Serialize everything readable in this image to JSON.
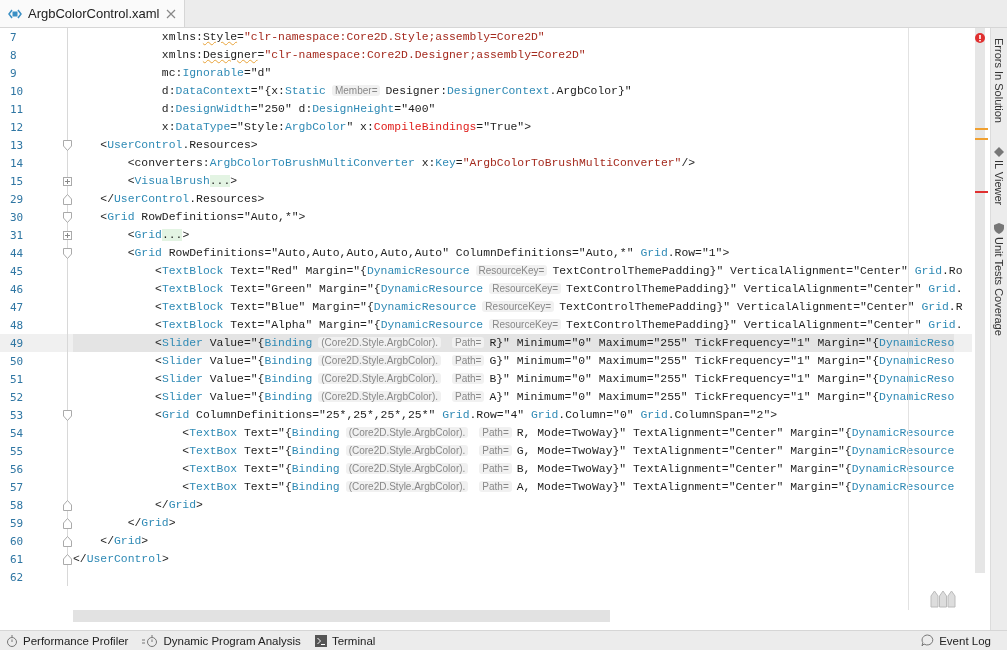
{
  "tabs": [
    {
      "label": "ArgbColorControl.xaml",
      "selected": true
    }
  ],
  "editor": {
    "lines": [
      {
        "number": "7",
        "current": false,
        "kind": "plain",
        "tokens": [
          {
            "kind": "p",
            "text": "             xmlns:"
          },
          {
            "kind": "w",
            "text": "Style"
          },
          {
            "kind": "p",
            "text": "="
          },
          {
            "kind": "s",
            "text": "\"clr-namespace:Core2D.Style;assembly=Core2D\""
          }
        ]
      },
      {
        "number": "8",
        "current": false,
        "kind": "plain",
        "tokens": [
          {
            "kind": "p",
            "text": "             xmlns:"
          },
          {
            "kind": "w",
            "text": "Designer"
          },
          {
            "kind": "p",
            "text": "="
          },
          {
            "kind": "s",
            "text": "\"clr-namespace:Core2D.Designer;assembly=Core2D\""
          }
        ]
      },
      {
        "number": "9",
        "current": false,
        "kind": "plain",
        "tokens": [
          {
            "kind": "p",
            "text": "             mc:"
          },
          {
            "kind": "t",
            "text": "Ignorable"
          },
          {
            "kind": "p",
            "text": "=\"d\""
          }
        ]
      },
      {
        "number": "10",
        "current": false,
        "kind": "plain",
        "tokens": [
          {
            "kind": "p",
            "text": "             d:"
          },
          {
            "kind": "t",
            "text": "DataContext"
          },
          {
            "kind": "p",
            "text": "=\"{x:"
          },
          {
            "kind": "t",
            "text": "Static"
          },
          {
            "kind": "h",
            "text": "Member="
          },
          {
            "kind": "p",
            "text": "Designer:"
          },
          {
            "kind": "t",
            "text": "DesignerContext"
          },
          {
            "kind": "p",
            "text": ".ArgbColor}\""
          }
        ]
      },
      {
        "number": "11",
        "current": false,
        "kind": "plain",
        "tokens": [
          {
            "kind": "p",
            "text": "             d:"
          },
          {
            "kind": "t",
            "text": "DesignWidth"
          },
          {
            "kind": "p",
            "text": "=\"250\" d:"
          },
          {
            "kind": "t",
            "text": "DesignHeight"
          },
          {
            "kind": "p",
            "text": "=\"400\""
          }
        ]
      },
      {
        "number": "12",
        "current": false,
        "kind": "plain",
        "tokens": [
          {
            "kind": "p",
            "text": "             x:"
          },
          {
            "kind": "t",
            "text": "DataType"
          },
          {
            "kind": "p",
            "text": "=\"Style:"
          },
          {
            "kind": "t",
            "text": "ArgbColor"
          },
          {
            "kind": "p",
            "text": "\" x:"
          },
          {
            "kind": "r",
            "text": "CompileBindings"
          },
          {
            "kind": "p",
            "text": "=\"True\">"
          }
        ]
      },
      {
        "number": "13",
        "current": false,
        "kind": "fold_start",
        "tokens": [
          {
            "kind": "p",
            "text": "    <"
          },
          {
            "kind": "t",
            "text": "UserControl"
          },
          {
            "kind": "p",
            "text": ".Resources>"
          }
        ]
      },
      {
        "number": "14",
        "current": false,
        "kind": "plain",
        "tokens": [
          {
            "kind": "p",
            "text": "        <converters:"
          },
          {
            "kind": "t",
            "text": "ArgbColorToBrushMultiConverter"
          },
          {
            "kind": "p",
            "text": " x:"
          },
          {
            "kind": "t",
            "text": "Key"
          },
          {
            "kind": "p",
            "text": "="
          },
          {
            "kind": "s",
            "text": "\"ArgbColorToBrushMultiConverter\""
          },
          {
            "kind": "p",
            "text": "/>"
          }
        ]
      },
      {
        "number": "15",
        "current": false,
        "kind": "collapsed",
        "tokens": [
          {
            "kind": "p",
            "text": "        <"
          },
          {
            "kind": "t",
            "text": "VisualBrush"
          },
          {
            "kind": "f",
            "text": "..."
          },
          {
            "kind": "p",
            "text": ">"
          }
        ]
      },
      {
        "number": "29",
        "current": false,
        "kind": "fold_end",
        "tokens": [
          {
            "kind": "p",
            "text": "    </"
          },
          {
            "kind": "t",
            "text": "UserControl"
          },
          {
            "kind": "p",
            "text": ".Resources>"
          }
        ]
      },
      {
        "number": "30",
        "current": false,
        "kind": "fold_start",
        "tokens": [
          {
            "kind": "p",
            "text": "    <"
          },
          {
            "kind": "t",
            "text": "Grid"
          },
          {
            "kind": "p",
            "text": " RowDefinitions=\"Auto,*\">"
          }
        ]
      },
      {
        "number": "31",
        "current": false,
        "kind": "collapsed",
        "tokens": [
          {
            "kind": "p",
            "text": "        <"
          },
          {
            "kind": "t",
            "text": "Grid"
          },
          {
            "kind": "f",
            "text": "..."
          },
          {
            "kind": "p",
            "text": ">"
          }
        ]
      },
      {
        "number": "44",
        "current": false,
        "kind": "fold_start",
        "tokens": [
          {
            "kind": "p",
            "text": "        <"
          },
          {
            "kind": "t",
            "text": "Grid"
          },
          {
            "kind": "p",
            "text": " RowDefinitions=\"Auto,Auto,Auto,Auto,Auto\" ColumnDefinitions=\"Auto,*\" "
          },
          {
            "kind": "t",
            "text": "Grid"
          },
          {
            "kind": "p",
            "text": ".Row=\"1\">"
          }
        ]
      },
      {
        "number": "45",
        "current": false,
        "kind": "plain",
        "tokens": [
          {
            "kind": "p",
            "text": "            <"
          },
          {
            "kind": "t",
            "text": "TextBlock"
          },
          {
            "kind": "p",
            "text": " Text=\"Red\" Margin=\"{"
          },
          {
            "kind": "t",
            "text": "DynamicResource"
          },
          {
            "kind": "h",
            "text": "ResourceKey="
          },
          {
            "kind": "p",
            "text": "TextControlThemePadding}\" VerticalAlignment=\"Center\" "
          },
          {
            "kind": "t",
            "text": "Grid"
          },
          {
            "kind": "p",
            "text": ".Ro"
          }
        ]
      },
      {
        "number": "46",
        "current": false,
        "kind": "plain",
        "tokens": [
          {
            "kind": "p",
            "text": "            <"
          },
          {
            "kind": "t",
            "text": "TextBlock"
          },
          {
            "kind": "p",
            "text": " Text=\"Green\" Margin=\"{"
          },
          {
            "kind": "t",
            "text": "DynamicResource"
          },
          {
            "kind": "h",
            "text": "ResourceKey="
          },
          {
            "kind": "p",
            "text": "TextControlThemePadding}\" VerticalAlignment=\"Center\" "
          },
          {
            "kind": "t",
            "text": "Grid"
          },
          {
            "kind": "p",
            "text": "."
          }
        ]
      },
      {
        "number": "47",
        "current": false,
        "kind": "plain",
        "tokens": [
          {
            "kind": "p",
            "text": "            <"
          },
          {
            "kind": "t",
            "text": "TextBlock"
          },
          {
            "kind": "p",
            "text": " Text=\"Blue\" Margin=\"{"
          },
          {
            "kind": "t",
            "text": "DynamicResource"
          },
          {
            "kind": "h",
            "text": "ResourceKey="
          },
          {
            "kind": "p",
            "text": "TextControlThemePadding}\" VerticalAlignment=\"Center\" "
          },
          {
            "kind": "t",
            "text": "Grid"
          },
          {
            "kind": "p",
            "text": ".R"
          }
        ]
      },
      {
        "number": "48",
        "current": false,
        "kind": "plain",
        "tokens": [
          {
            "kind": "p",
            "text": "            <"
          },
          {
            "kind": "t",
            "text": "TextBlock"
          },
          {
            "kind": "p",
            "text": " Text=\"Alpha\" Margin=\"{"
          },
          {
            "kind": "t",
            "text": "DynamicResource"
          },
          {
            "kind": "h",
            "text": "ResourceKey="
          },
          {
            "kind": "p",
            "text": "TextControlThemePadding}\" VerticalAlignment=\"Center\" "
          },
          {
            "kind": "t",
            "text": "Grid"
          },
          {
            "kind": "p",
            "text": "."
          }
        ]
      },
      {
        "number": "49",
        "current": true,
        "kind": "plain",
        "tokens": [
          {
            "kind": "p",
            "text": "            <"
          },
          {
            "kind": "t",
            "text": "Slider"
          },
          {
            "kind": "p",
            "text": " Value=\"{"
          },
          {
            "kind": "t",
            "text": "Binding"
          },
          {
            "kind": "h",
            "text": "(Core2D.Style.ArgbColor)."
          },
          {
            "kind": "h",
            "text": "Path="
          },
          {
            "kind": "p",
            "text": "R}\" Minimum=\"0\" Maximum=\"255\" TickFrequency=\"1\" Margin=\"{"
          },
          {
            "kind": "t",
            "text": "DynamicReso"
          }
        ]
      },
      {
        "number": "50",
        "current": false,
        "kind": "plain",
        "tokens": [
          {
            "kind": "p",
            "text": "            <"
          },
          {
            "kind": "t",
            "text": "Slider"
          },
          {
            "kind": "p",
            "text": " Value=\"{"
          },
          {
            "kind": "t",
            "text": "Binding"
          },
          {
            "kind": "h",
            "text": "(Core2D.Style.ArgbColor)."
          },
          {
            "kind": "h",
            "text": "Path="
          },
          {
            "kind": "p",
            "text": "G}\" Minimum=\"0\" Maximum=\"255\" TickFrequency=\"1\" Margin=\"{"
          },
          {
            "kind": "t",
            "text": "DynamicReso"
          }
        ]
      },
      {
        "number": "51",
        "current": false,
        "kind": "plain",
        "tokens": [
          {
            "kind": "p",
            "text": "            <"
          },
          {
            "kind": "t",
            "text": "Slider"
          },
          {
            "kind": "p",
            "text": " Value=\"{"
          },
          {
            "kind": "t",
            "text": "Binding"
          },
          {
            "kind": "h",
            "text": "(Core2D.Style.ArgbColor)."
          },
          {
            "kind": "h",
            "text": "Path="
          },
          {
            "kind": "p",
            "text": "B}\" Minimum=\"0\" Maximum=\"255\" TickFrequency=\"1\" Margin=\"{"
          },
          {
            "kind": "t",
            "text": "DynamicReso"
          }
        ]
      },
      {
        "number": "52",
        "current": false,
        "kind": "plain",
        "tokens": [
          {
            "kind": "p",
            "text": "            <"
          },
          {
            "kind": "t",
            "text": "Slider"
          },
          {
            "kind": "p",
            "text": " Value=\"{"
          },
          {
            "kind": "t",
            "text": "Binding"
          },
          {
            "kind": "h",
            "text": "(Core2D.Style.ArgbColor)."
          },
          {
            "kind": "h",
            "text": "Path="
          },
          {
            "kind": "p",
            "text": "A}\" Minimum=\"0\" Maximum=\"255\" TickFrequency=\"1\" Margin=\"{"
          },
          {
            "kind": "t",
            "text": "DynamicReso"
          }
        ]
      },
      {
        "number": "53",
        "current": false,
        "kind": "fold_start",
        "tokens": [
          {
            "kind": "p",
            "text": "            <"
          },
          {
            "kind": "t",
            "text": "Grid"
          },
          {
            "kind": "p",
            "text": " ColumnDefinitions=\"25*,25*,25*,25*\" "
          },
          {
            "kind": "t",
            "text": "Grid"
          },
          {
            "kind": "p",
            "text": ".Row=\"4\" "
          },
          {
            "kind": "t",
            "text": "Grid"
          },
          {
            "kind": "p",
            "text": ".Column=\"0\" "
          },
          {
            "kind": "t",
            "text": "Grid"
          },
          {
            "kind": "p",
            "text": ".ColumnSpan=\"2\">"
          }
        ]
      },
      {
        "number": "54",
        "current": false,
        "kind": "plain",
        "tokens": [
          {
            "kind": "p",
            "text": "                <"
          },
          {
            "kind": "t",
            "text": "TextBox"
          },
          {
            "kind": "p",
            "text": " Text=\"{"
          },
          {
            "kind": "t",
            "text": "Binding"
          },
          {
            "kind": "h",
            "text": "(Core2D.Style.ArgbColor)."
          },
          {
            "kind": "h",
            "text": "Path="
          },
          {
            "kind": "p",
            "text": "R, Mode=TwoWay}\" TextAlignment=\"Center\" Margin=\"{"
          },
          {
            "kind": "t",
            "text": "DynamicResource"
          }
        ]
      },
      {
        "number": "55",
        "current": false,
        "kind": "plain",
        "tokens": [
          {
            "kind": "p",
            "text": "                <"
          },
          {
            "kind": "t",
            "text": "TextBox"
          },
          {
            "kind": "p",
            "text": " Text=\"{"
          },
          {
            "kind": "t",
            "text": "Binding"
          },
          {
            "kind": "h",
            "text": "(Core2D.Style.ArgbColor)."
          },
          {
            "kind": "h",
            "text": "Path="
          },
          {
            "kind": "p",
            "text": "G, Mode=TwoWay}\" TextAlignment=\"Center\" Margin=\"{"
          },
          {
            "kind": "t",
            "text": "DynamicResource"
          }
        ]
      },
      {
        "number": "56",
        "current": false,
        "kind": "plain",
        "tokens": [
          {
            "kind": "p",
            "text": "                <"
          },
          {
            "kind": "t",
            "text": "TextBox"
          },
          {
            "kind": "p",
            "text": " Text=\"{"
          },
          {
            "kind": "t",
            "text": "Binding"
          },
          {
            "kind": "h",
            "text": "(Core2D.Style.ArgbColor)."
          },
          {
            "kind": "h",
            "text": "Path="
          },
          {
            "kind": "p",
            "text": "B, Mode=TwoWay}\" TextAlignment=\"Center\" Margin=\"{"
          },
          {
            "kind": "t",
            "text": "DynamicResource"
          }
        ]
      },
      {
        "number": "57",
        "current": false,
        "kind": "plain",
        "tokens": [
          {
            "kind": "p",
            "text": "                <"
          },
          {
            "kind": "t",
            "text": "TextBox"
          },
          {
            "kind": "p",
            "text": " Text=\"{"
          },
          {
            "kind": "t",
            "text": "Binding"
          },
          {
            "kind": "h",
            "text": "(Core2D.Style.ArgbColor)."
          },
          {
            "kind": "h",
            "text": "Path="
          },
          {
            "kind": "p",
            "text": "A, Mode=TwoWay}\" TextAlignment=\"Center\" Margin=\"{"
          },
          {
            "kind": "t",
            "text": "DynamicResource"
          }
        ]
      },
      {
        "number": "58",
        "current": false,
        "kind": "fold_end",
        "tokens": [
          {
            "kind": "p",
            "text": "            </"
          },
          {
            "kind": "t",
            "text": "Grid"
          },
          {
            "kind": "p",
            "text": ">"
          }
        ]
      },
      {
        "number": "59",
        "current": false,
        "kind": "fold_end",
        "tokens": [
          {
            "kind": "p",
            "text": "        </"
          },
          {
            "kind": "t",
            "text": "Grid"
          },
          {
            "kind": "p",
            "text": ">"
          }
        ]
      },
      {
        "number": "60",
        "current": false,
        "kind": "fold_end",
        "tokens": [
          {
            "kind": "p",
            "text": "    </"
          },
          {
            "kind": "t",
            "text": "Grid"
          },
          {
            "kind": "p",
            "text": ">"
          }
        ]
      },
      {
        "number": "61",
        "current": false,
        "kind": "fold_end",
        "tokens": [
          {
            "kind": "p",
            "text": "</"
          },
          {
            "kind": "t",
            "text": "UserControl"
          },
          {
            "kind": "p",
            "text": ">"
          }
        ]
      },
      {
        "number": "62",
        "current": false,
        "kind": "plain"
      }
    ]
  },
  "tool_windows": [
    {
      "label": "Errors In Solution",
      "kind": "errors"
    },
    {
      "label": "IL Viewer",
      "kind": "il"
    },
    {
      "label": "Unit Tests Coverage",
      "kind": "coverage"
    }
  ],
  "status_bar": {
    "items": [
      {
        "label": "Performance Profiler",
        "kind": "profiler"
      },
      {
        "label": "Dynamic Program Analysis",
        "kind": "analysis"
      },
      {
        "label": "Terminal",
        "kind": "terminal"
      }
    ],
    "event_log": "Event Log"
  }
}
